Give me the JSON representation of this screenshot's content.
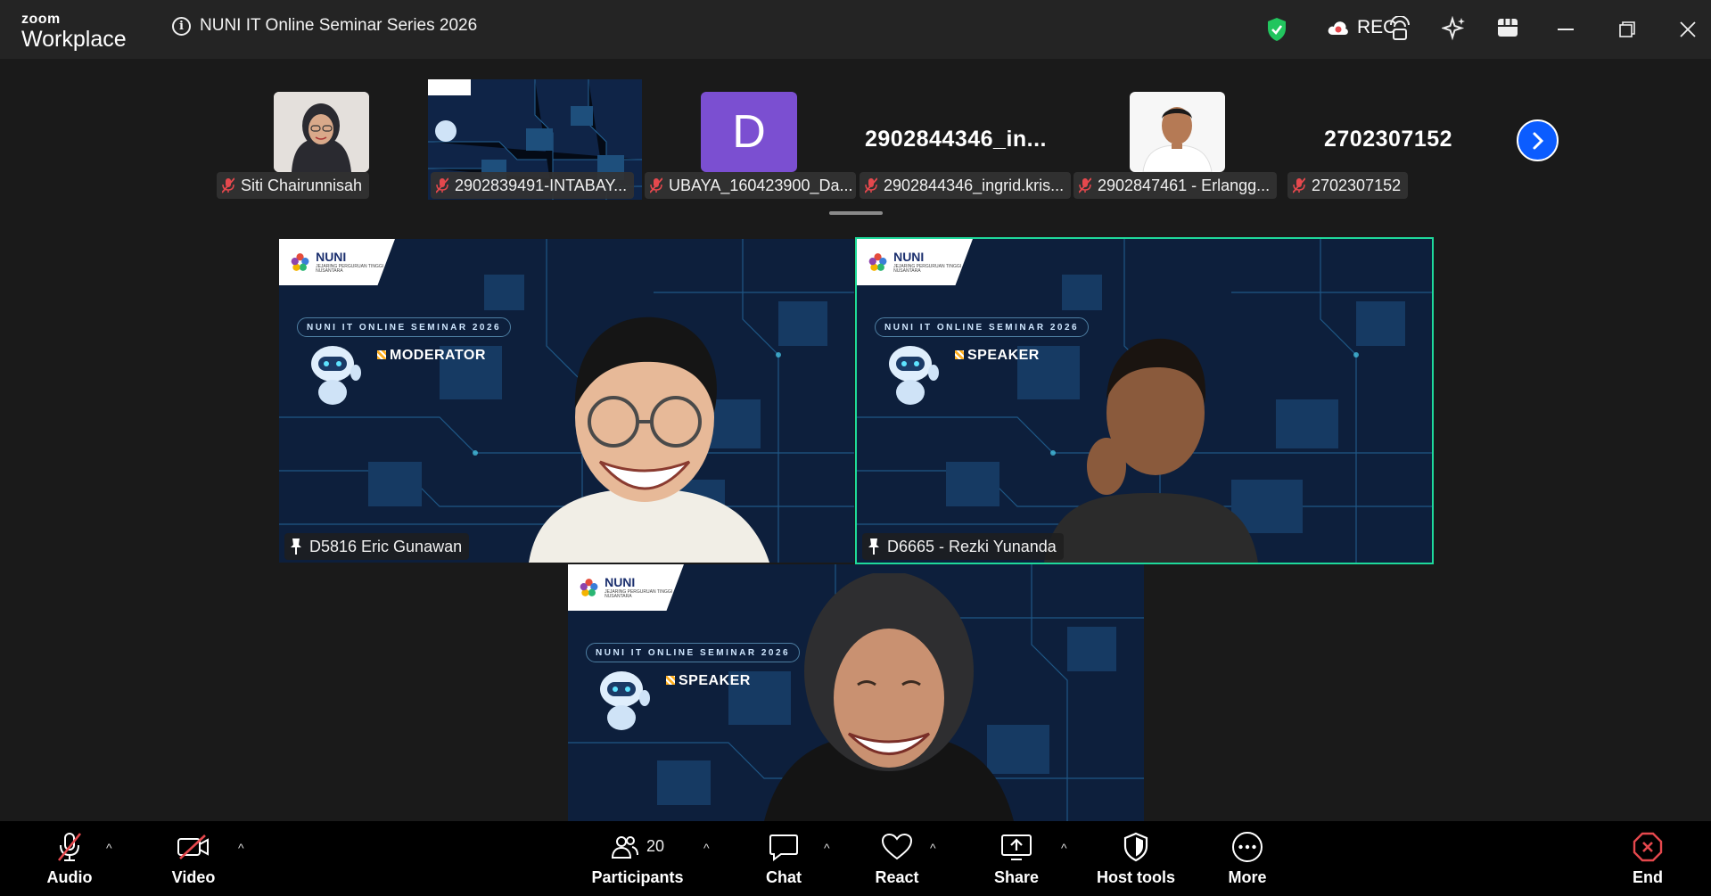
{
  "app": {
    "logo_line1": "zoom",
    "logo_line2": "Workplace",
    "meeting_title": "NUNI IT Online Seminar Series 2026",
    "rec_label": "REC"
  },
  "filmstrip": [
    {
      "name": "Siti Chairunnisah",
      "type": "photo"
    },
    {
      "name": "2902839491-INTABAY...",
      "type": "screen"
    },
    {
      "name": "UBAYA_160423900_Da...",
      "type": "avatar",
      "avatar_letter": "D"
    },
    {
      "name": "2902844346_ingrid.kris...",
      "type": "text",
      "display_text": "2902844346_in..."
    },
    {
      "name": "2902847461 - Erlangg...",
      "type": "photo"
    },
    {
      "name": "2702307152",
      "type": "text",
      "display_text": "2702307152"
    }
  ],
  "videos": [
    {
      "name": "D5816 Eric Gunawan",
      "role": "MODERATOR",
      "seminar": "NUNI IT ONLINE SEMINAR 2026",
      "brand": "NUNI",
      "brand_sub": "JEJARING PERGURUAN TINGGI NUSANTARA",
      "active": false
    },
    {
      "name": "D6665 - Rezki Yunanda",
      "role": "SPEAKER",
      "seminar": "NUNI IT ONLINE SEMINAR 2026",
      "brand": "NUNI",
      "brand_sub": "JEJARING PERGURUAN TINGGI NUSANTARA",
      "active": true
    },
    {
      "name": "",
      "role": "SPEAKER",
      "seminar": "NUNI IT ONLINE SEMINAR 2026",
      "brand": "NUNI",
      "brand_sub": "JEJARING PERGURUAN TINGGI NUSANTARA",
      "active": false
    }
  ],
  "toolbar": {
    "audio": "Audio",
    "video": "Video",
    "participants": "Participants",
    "participants_count": "20",
    "chat": "Chat",
    "react": "React",
    "share": "Share",
    "host_tools": "Host tools",
    "more": "More",
    "end": "End"
  },
  "colors": {
    "accent_blue": "#0b5cff",
    "active_speaker": "#1ed99b",
    "muted_red": "#e5484d",
    "shield_green": "#22c55e"
  }
}
